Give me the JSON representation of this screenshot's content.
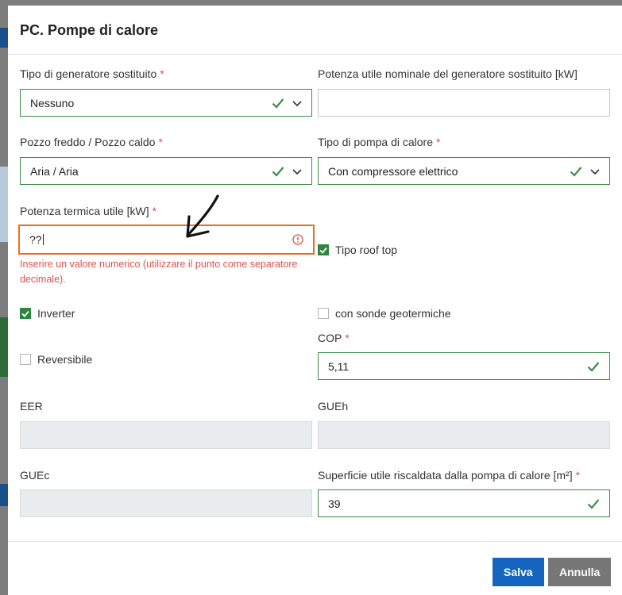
{
  "dialog": {
    "title": "PC. Pompe di calore"
  },
  "fields": {
    "generator_type": {
      "label": "Tipo di generatore sostituito",
      "required": "*",
      "value": "Nessuno"
    },
    "nominal_power": {
      "label": "Potenza utile nominale del generatore sostituito [kW]",
      "value": ""
    },
    "well": {
      "label": "Pozzo freddo / Pozzo caldo",
      "required": "*",
      "value": "Aria / Aria"
    },
    "pump_type": {
      "label": "Tipo di pompa di calore",
      "required": "*",
      "value": "Con compressore elettrico"
    },
    "thermal_power": {
      "label": "Potenza termica utile [kW]",
      "required": "*",
      "value": "??",
      "error": "Inserire un valore numerico (utilizzare il punto come separatore decimale)."
    },
    "cop": {
      "label": "COP",
      "required": "*",
      "value": "5,11"
    },
    "eer": {
      "label": "EER",
      "value": ""
    },
    "gueh": {
      "label": "GUEh",
      "value": ""
    },
    "guec": {
      "label": "GUEc",
      "value": ""
    },
    "surface": {
      "label": "Superficie utile riscaldata dalla pompa di calore [m²]",
      "required": "*",
      "value": "39"
    }
  },
  "checkboxes": {
    "roof_top": {
      "label": "Tipo roof top",
      "checked": true
    },
    "inverter": {
      "label": "Inverter",
      "checked": true
    },
    "geothermal": {
      "label": "con sonde geotermiche",
      "checked": false
    },
    "reversible": {
      "label": "Reversibile",
      "checked": false
    }
  },
  "footer": {
    "save_label": "Salva",
    "cancel_label": "Annulla"
  },
  "colors": {
    "valid": "#3c8b4a",
    "error": "#e8711f",
    "primary": "#1565c0"
  }
}
